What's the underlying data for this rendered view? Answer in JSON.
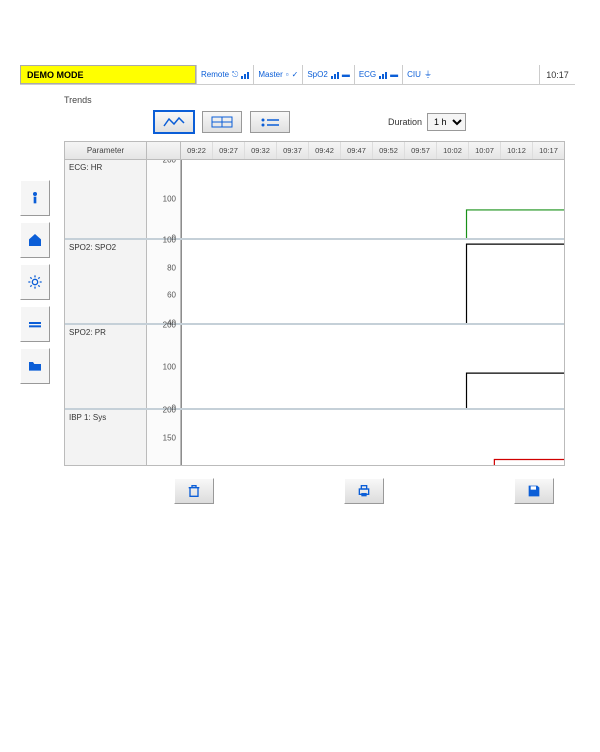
{
  "topbar": {
    "mode_label": "DEMO MODE",
    "status": [
      {
        "label": "Remote"
      },
      {
        "label": "Master"
      },
      {
        "label": "SpO2"
      },
      {
        "label": "ECG"
      },
      {
        "label": "CIU"
      }
    ],
    "time": "10:17"
  },
  "section_title": "Trends",
  "controls": {
    "duration_label": "Duration",
    "duration_value": "1 h"
  },
  "left_rail": [
    "patient",
    "home",
    "settings",
    "layout",
    "folder"
  ],
  "chart_data": {
    "type": "line",
    "param_header": "Parameter",
    "time_ticks": [
      "09:22",
      "09:27",
      "09:32",
      "09:37",
      "09:42",
      "09:47",
      "09:52",
      "09:57",
      "10:02",
      "10:07",
      "10:12",
      "10:17"
    ],
    "rows": [
      {
        "name": "ECG: HR",
        "ymin": 0,
        "ymax": 200,
        "ticks": [
          200,
          100,
          0
        ],
        "color": "#189018",
        "series": [
          {
            "t": "10:03",
            "v": 0
          },
          {
            "t": "10:03",
            "v": 72
          },
          {
            "t": "10:17",
            "v": 72
          }
        ]
      },
      {
        "name": "SPO2: SPO2",
        "ymin": 40,
        "ymax": 100,
        "ticks": [
          100,
          80,
          60,
          40
        ],
        "color": "#000000",
        "series": [
          {
            "t": "10:03",
            "v": 40
          },
          {
            "t": "10:03",
            "v": 97
          },
          {
            "t": "10:17",
            "v": 97
          }
        ]
      },
      {
        "name": "SPO2: PR",
        "ymin": 0,
        "ymax": 200,
        "ticks": [
          200,
          100,
          0
        ],
        "color": "#000000",
        "series": [
          {
            "t": "10:03",
            "v": 0
          },
          {
            "t": "10:03",
            "v": 84
          },
          {
            "t": "10:17",
            "v": 84
          }
        ]
      },
      {
        "name": "IBP 1: Sys",
        "ymin": 100,
        "ymax": 200,
        "ticks": [
          200,
          150
        ],
        "color": "#d00000",
        "series": [
          {
            "t": "10:07",
            "v": 100
          },
          {
            "t": "10:07",
            "v": 110
          },
          {
            "t": "10:17",
            "v": 110
          }
        ],
        "truncated": true
      }
    ]
  },
  "bottom_buttons": [
    "trash",
    "print",
    "save"
  ]
}
